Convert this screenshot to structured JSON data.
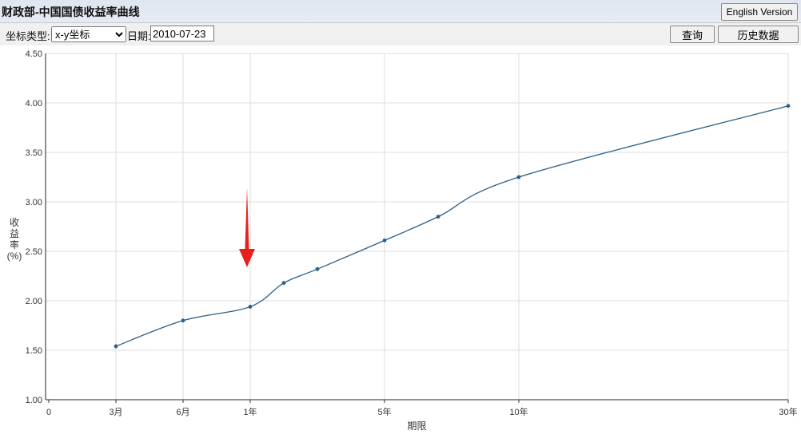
{
  "title": "财政部-中国国债收益率曲线",
  "english_button": "English Version",
  "toolbar": {
    "coord_label": "坐标类型:",
    "coord_selected": "x-y坐标",
    "date_label": "日期:",
    "date_value": "2010-07-23",
    "query_button": "查询",
    "history_button": "历史数据"
  },
  "colors": {
    "line": "#2d5f86",
    "grid": "#dddddd",
    "arrow": "#e8201c"
  },
  "icons": [
    "red-arrow-down-icon"
  ],
  "chart_data": {
    "type": "line",
    "title": "",
    "xlabel": "期限",
    "ylabel": "收益率(%)",
    "xlim": [
      0,
      30
    ],
    "ylim": [
      1.0,
      4.5
    ],
    "grid": true,
    "x_ticks": [
      {
        "x": 0,
        "label": "0"
      },
      {
        "x": 0.25,
        "label": "3月"
      },
      {
        "x": 0.5,
        "label": "6月"
      },
      {
        "x": 1,
        "label": "1年"
      },
      {
        "x": 5,
        "label": "5年"
      },
      {
        "x": 10,
        "label": "10年"
      },
      {
        "x": 30,
        "label": "30年"
      }
    ],
    "y_ticks": [
      "1.00",
      "1.50",
      "2.00",
      "2.50",
      "3.00",
      "3.50",
      "4.00",
      "4.50"
    ],
    "points": [
      {
        "x": 0.25,
        "y": 1.54
      },
      {
        "x": 0.5,
        "y": 1.8
      },
      {
        "x": 1,
        "y": 1.94
      },
      {
        "x": 2,
        "y": 2.18
      },
      {
        "x": 3,
        "y": 2.32
      },
      {
        "x": 5,
        "y": 2.61
      },
      {
        "x": 7,
        "y": 2.85
      },
      {
        "x": 10,
        "y": 3.25
      },
      {
        "x": 30,
        "y": 3.97
      }
    ],
    "annotation": {
      "type": "arrow",
      "x": 1,
      "pointing": "down"
    }
  }
}
